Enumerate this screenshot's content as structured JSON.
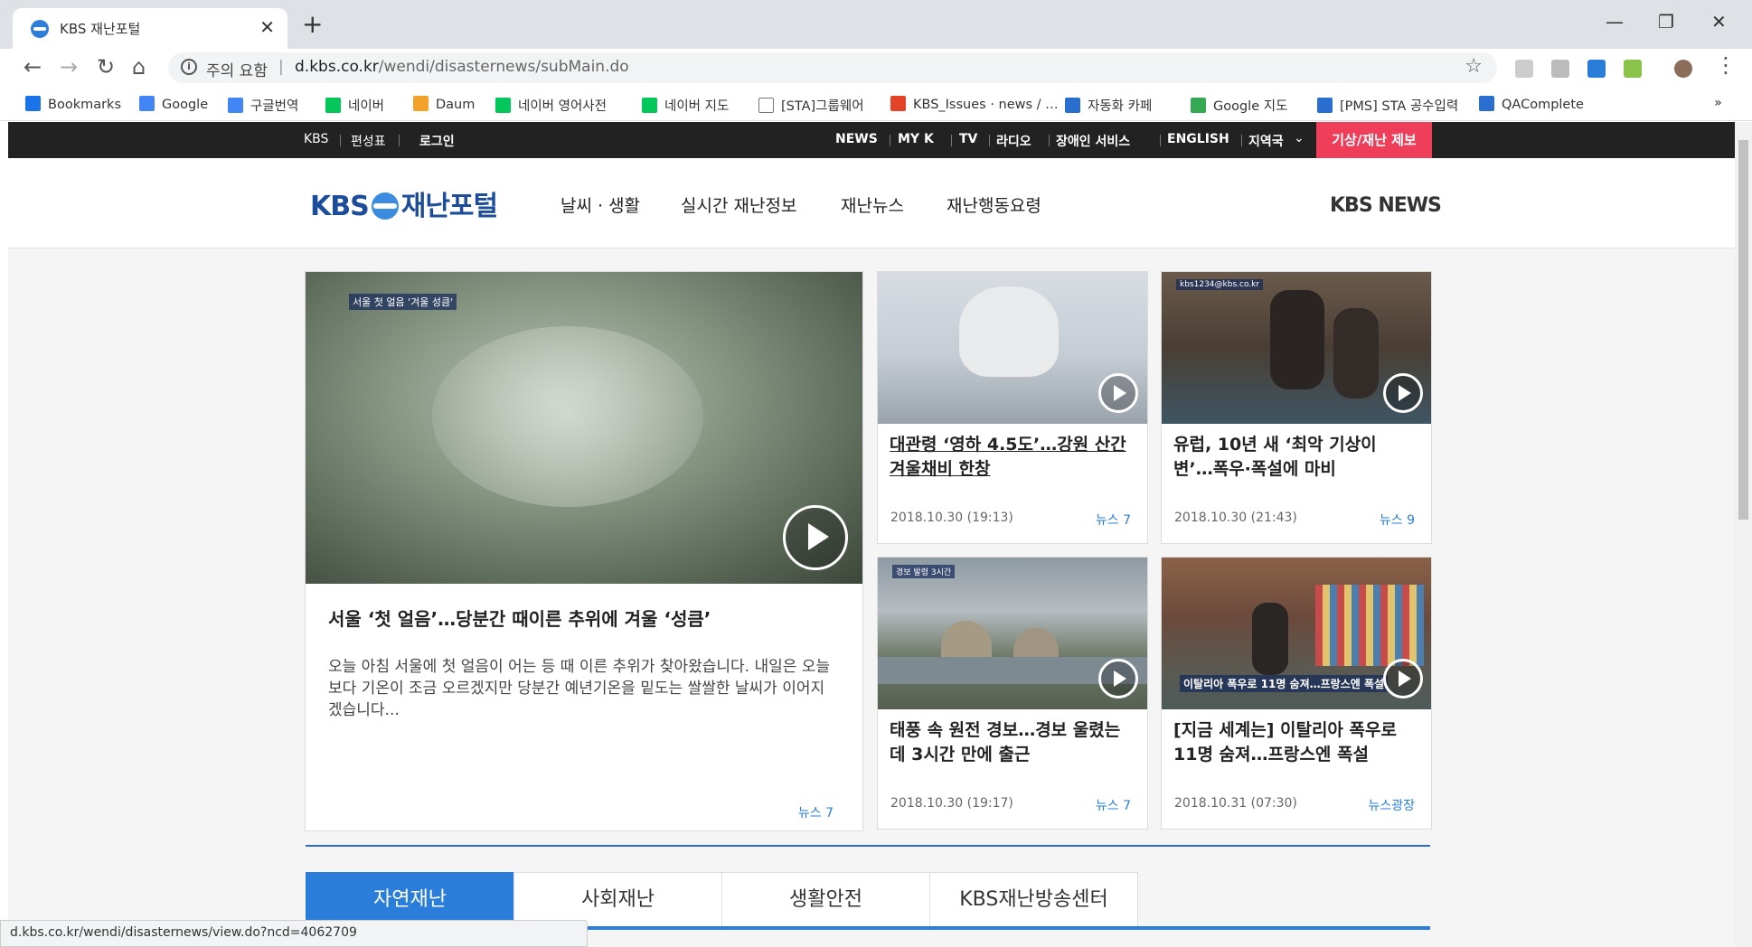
{
  "browser": {
    "tab_title": "KBS 재난포털",
    "tab_close": "✕",
    "new_tab": "+",
    "minimize": "—",
    "maximize": "❐",
    "close_window": "✕",
    "security_label": "주의 요함",
    "url_host": "d.kbs.co.kr",
    "url_path": "/wendi/disasternews/subMain.do",
    "bookmarks": [
      {
        "label": "Bookmarks",
        "icon": "star-icon",
        "color": "#1a73e8"
      },
      {
        "label": "Google",
        "icon": "google-icon",
        "color": "#4285f4"
      },
      {
        "label": "구글번역",
        "icon": "translate-icon",
        "color": "#4285f4"
      },
      {
        "label": "네이버",
        "icon": "naver-icon",
        "color": "#03c75a"
      },
      {
        "label": "Daum",
        "icon": "daum-icon",
        "color": "#f2a12b"
      },
      {
        "label": "네이버 영어사전",
        "icon": "dict-icon",
        "color": "#03c75a"
      },
      {
        "label": "네이버 지도",
        "icon": "naver-icon",
        "color": "#03c75a"
      },
      {
        "label": "[STA]그룹웨어",
        "icon": "page-icon",
        "color": "#ffffff"
      },
      {
        "label": "KBS_Issues · news / …",
        "icon": "gitlab-icon",
        "color": "#e24329"
      },
      {
        "label": "자동화 카페",
        "icon": "cafe-icon",
        "color": "#2a6fd0"
      },
      {
        "label": "Google 지도",
        "icon": "maps-icon",
        "color": "#34a853"
      },
      {
        "label": "[PMS] STA 공수입력",
        "icon": "pms-icon",
        "color": "#2a6fd0"
      },
      {
        "label": "QAComplete",
        "icon": "qa-icon",
        "color": "#2a6fd0"
      }
    ],
    "more_bookmarks": "»",
    "status_url": "d.kbs.co.kr/wendi/disasternews/view.do?ncd=4062709"
  },
  "topbar": {
    "left": [
      "KBS",
      "편성표",
      "로그인"
    ],
    "right": [
      "NEWS",
      "MY K",
      "TV",
      "라디오",
      "장애인 서비스",
      "ENGLISH",
      "지역국"
    ],
    "report": "기상/재난 제보"
  },
  "header": {
    "logo_kbs": "KBS",
    "logo_text": "재난포털",
    "nav": [
      "날씨 · 생활",
      "실시간 재난정보",
      "재난뉴스",
      "재난행동요령"
    ],
    "kbs_news": "KBS NEWS"
  },
  "lead": {
    "caption": "서울 첫 얼음 '겨울 성큼'",
    "title": "서울 ‘첫 얼음’…당분간 때이른 추위에 겨울 ‘성큼’",
    "desc": "오늘 아침 서울에 첫 얼음이 어는 등 때 이른 추위가 찾아왔습니다. 내일은 오늘보다 기온이 조금 오르겠지만 당분간 예년기온을 밑도는 쌀쌀한 날씨가 이어지겠습니다...",
    "source": "뉴스 7"
  },
  "cards": [
    {
      "title": "대관령 ‘영하 4.5도’…강원 산간 겨울채비 한창",
      "date": "2018.10.30 (19:13)",
      "source": "뉴스 7",
      "caption": ""
    },
    {
      "title": "유럽, 10년 새 ‘최악 기상이 변’…폭우·폭설에 마비",
      "date": "2018.10.30 (21:43)",
      "source": "뉴스 9",
      "caption": "kbs1234@kbs.co.kr"
    },
    {
      "title": "태풍 속 원전 경보…경보 울렸는데 3시간 만에 출근",
      "date": "2018.10.30 (19:17)",
      "source": "뉴스 7",
      "caption": "경보 발령 3시간"
    },
    {
      "title": "[지금 세계는] 이탈리아 폭우로 11명 숨져…프랑스엔 폭설",
      "date": "2018.10.31 (07:30)",
      "source": "뉴스광장",
      "caption": "이탈리아 폭우로 11명 숨져…프랑스엔 폭설"
    }
  ],
  "tabs": [
    "자연재난",
    "사회재난",
    "생활안전",
    "KBS재난방송센터"
  ]
}
